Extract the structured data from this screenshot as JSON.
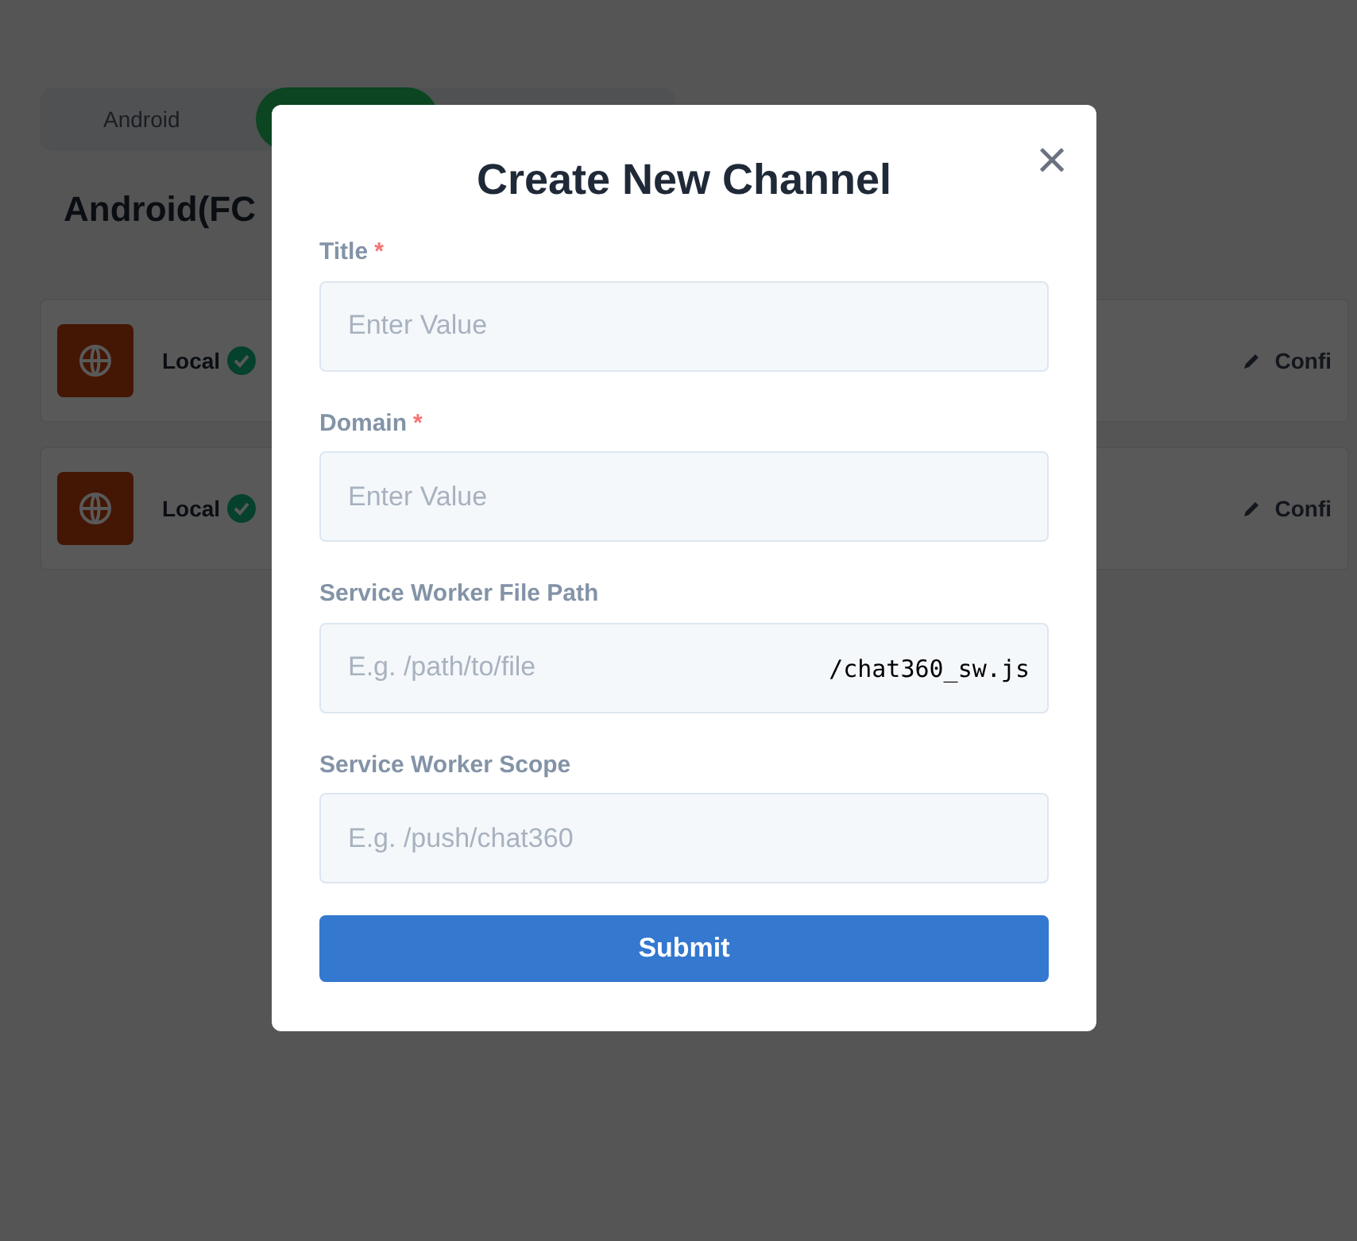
{
  "background": {
    "tabs": [
      {
        "label": "Android",
        "selected": false
      },
      {
        "selected": true
      }
    ],
    "heading": "Android(FC",
    "channels": [
      {
        "name": "Local",
        "verified": true,
        "action": "Confi"
      },
      {
        "name": "Local",
        "verified": true,
        "action": "Confi"
      }
    ]
  },
  "modal": {
    "title": "Create New Channel",
    "close": "×",
    "fields": [
      {
        "label": "Title",
        "required_mark": "*",
        "placeholder": "Enter Value"
      },
      {
        "label": "Domain",
        "required_mark": "*",
        "placeholder": "Enter Value"
      },
      {
        "label": "Service Worker File Path",
        "placeholder": "E.g. /path/to/file",
        "suffix": "/chat360_sw.js"
      },
      {
        "label": "Service Worker Scope",
        "placeholder": "E.g. /push/chat360"
      }
    ],
    "submit": "Submit"
  }
}
